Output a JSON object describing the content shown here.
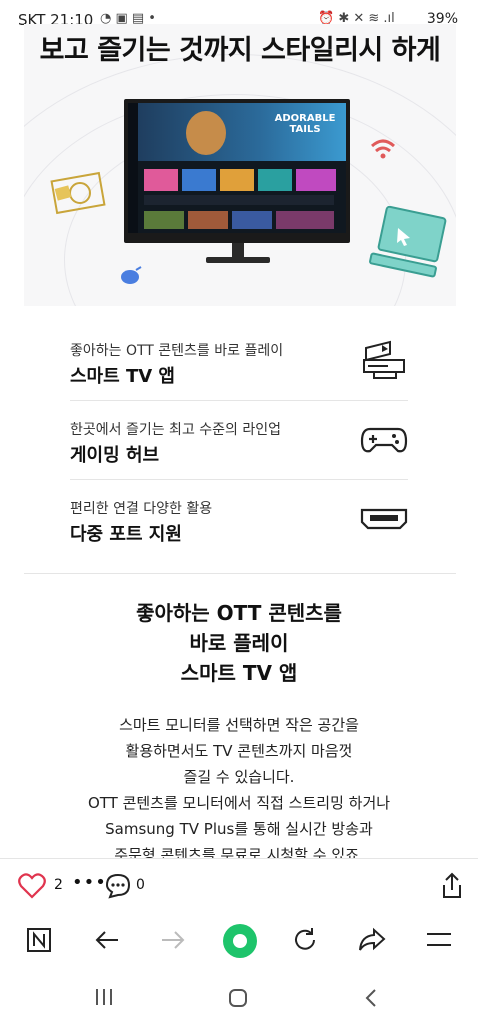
{
  "status_bar": {
    "carrier_time": "SKT 21:10",
    "battery": "39%"
  },
  "hero": {
    "title": "보고 즐기는 것까지 스타일리시 하게",
    "screen_heading": "ADORABLE TAILS"
  },
  "features": [
    {
      "subtitle": "좋아하는 OTT 콘텐츠를 바로 플레이",
      "title": "스마트 TV 앱"
    },
    {
      "subtitle": "한곳에서 즐기는 최고 수준의 라인업",
      "title": "게이밍 허브"
    },
    {
      "subtitle": "편리한 연결 다양한 활용",
      "title": "다중 포트 지원"
    }
  ],
  "section": {
    "heading_lines": [
      "좋아하는 OTT 콘텐츠를",
      "바로 플레이",
      "스마트 TV 앱"
    ],
    "body_lines": [
      "스마트 모니터를 선택하면 작은 공간을",
      "활용하면서도 TV 콘텐츠까지 마음껏",
      "즐길 수 있습니다.",
      "OTT 콘텐츠를 모니터에서 직접 스트리밍 하거나",
      "Samsung TV Plus를 통해 실시간 방송과",
      "주문형 콘텐츠를 무료로 시청할 수 있죠."
    ]
  },
  "actions": {
    "like_count": "2",
    "comment_count": "0"
  },
  "colors": {
    "accent_green": "#1ec46b",
    "like_red": "#e0344e"
  }
}
